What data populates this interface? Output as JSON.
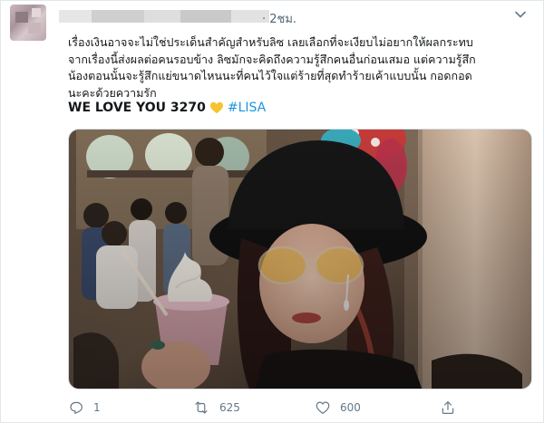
{
  "tweet": {
    "time": "· 2ชม.",
    "text_lines": [
      "เรื่องเงินอาจจะไม่ใช่ประเด็นสำคัญสำหรับลิซ เลยเลือกที่จะเงียบไม่อยากให้ผลกระทบ",
      "จากเรื่องนี้ส่งผลต่อคนรอบข้าง ลิซมักจะคิดถึงความรู้สึกคนอื่นก่อนเสมอ แต่ความรู้สึก",
      "น้องตอนนั้นจะรู้สึกแย่ขนาดไหนนะที่คนไว้ใจแต่ร้ายที่สุดทำร้ายเค้าแบบนั้น กอดกอด",
      "นะคะด้วยความรัก"
    ],
    "love_line": "WE LOVE YOU 3270",
    "hashtag": "#LISA",
    "heart_color": "#f7c331"
  },
  "actions": {
    "replies": "1",
    "retweets": "625",
    "likes": "600"
  },
  "icons": {
    "reply": "reply-icon",
    "retweet": "retweet-icon",
    "like": "heart-icon",
    "share": "share-icon",
    "menu": "chevron-down-icon"
  }
}
